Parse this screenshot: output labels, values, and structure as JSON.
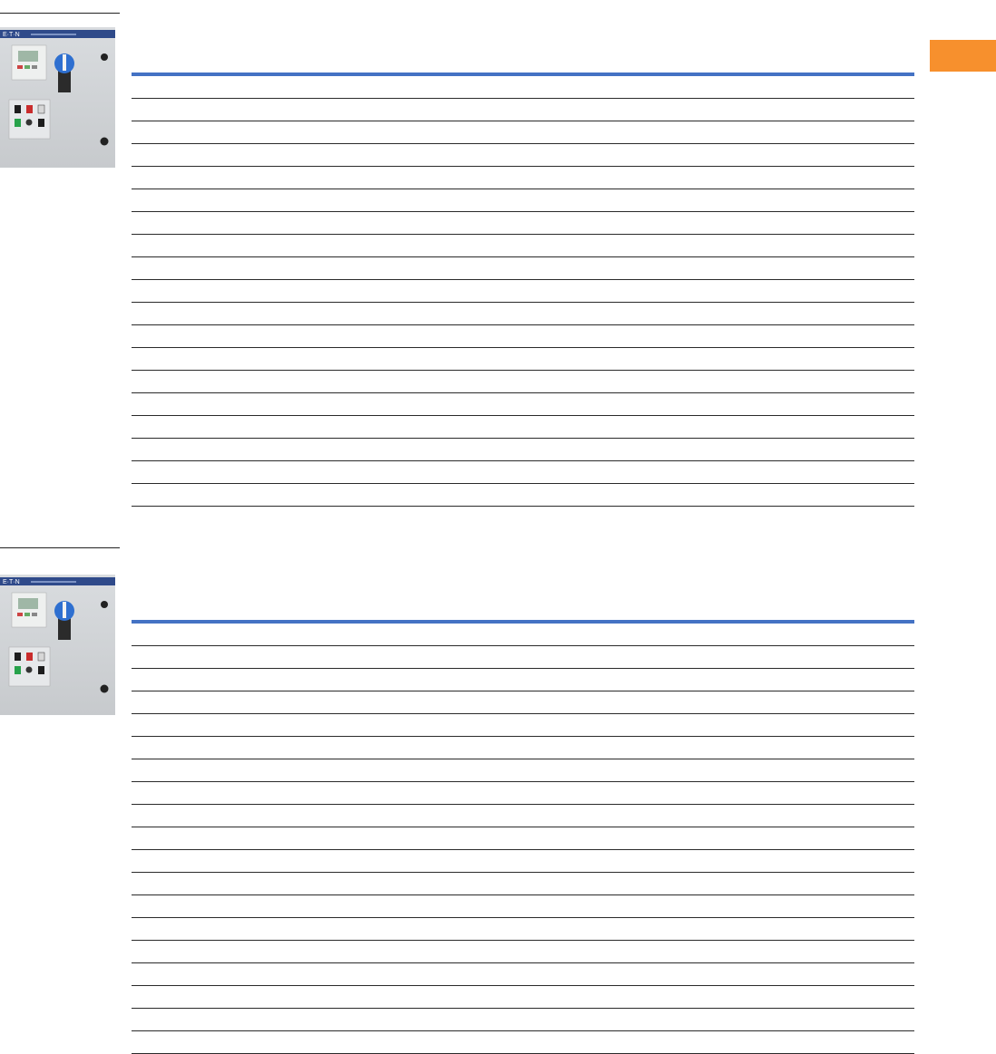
{
  "accent_color": "#f7902d",
  "table_rule_color": "#4472c4",
  "sections": [
    {
      "id": "section-1",
      "photo": {
        "brand_text": "E·T·N",
        "icon": "control-panel-photo"
      },
      "rows": [
        "",
        "",
        "",
        "",
        "",
        "",
        "",
        "",
        "",
        "",
        "",
        "",
        "",
        "",
        "",
        "",
        "",
        "",
        ""
      ]
    },
    {
      "id": "section-2",
      "photo": {
        "brand_text": "E·T·N",
        "icon": "control-panel-photo"
      },
      "rows": [
        "",
        "",
        "",
        "",
        "",
        "",
        "",
        "",
        "",
        "",
        "",
        "",
        "",
        "",
        "",
        "",
        "",
        "",
        ""
      ]
    }
  ]
}
